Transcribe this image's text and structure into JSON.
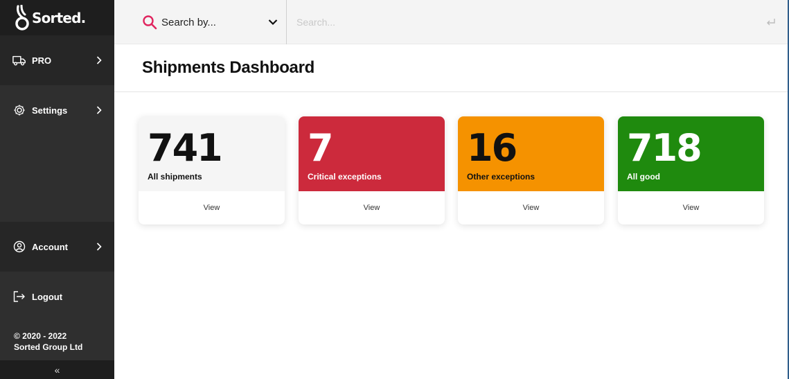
{
  "brand": {
    "name": "Sorted."
  },
  "sidebar": {
    "items": [
      {
        "label": "PRO",
        "icon": "truck-icon"
      },
      {
        "label": "Settings",
        "icon": "gear-icon"
      }
    ],
    "account": {
      "label": "Account",
      "icon": "user-circle-icon"
    },
    "logout": {
      "label": "Logout",
      "icon": "logout-icon"
    },
    "footer": {
      "line1": "© 2020 - 2022",
      "line2": "Sorted Group Ltd"
    },
    "collapse_icon": "«"
  },
  "search": {
    "by_label": "Search by...",
    "placeholder": "Search...",
    "value": ""
  },
  "page": {
    "title": "Shipments Dashboard"
  },
  "cards": [
    {
      "value": "741",
      "label": "All shipments",
      "view": "View",
      "bg": "#f5f5f5",
      "fg": "#111111"
    },
    {
      "value": "7",
      "label": "Critical exceptions",
      "view": "View",
      "bg": "#cc2a3c",
      "fg": "#ffffff"
    },
    {
      "value": "16",
      "label": "Other exceptions",
      "view": "View",
      "bg": "#f59200",
      "fg": "#111111"
    },
    {
      "value": "718",
      "label": "All good",
      "view": "View",
      "bg": "#1f8a0e",
      "fg": "#ffffff"
    }
  ],
  "colors": {
    "accent": "#e0245e",
    "sidebar_bg": "#2f2f2f"
  }
}
